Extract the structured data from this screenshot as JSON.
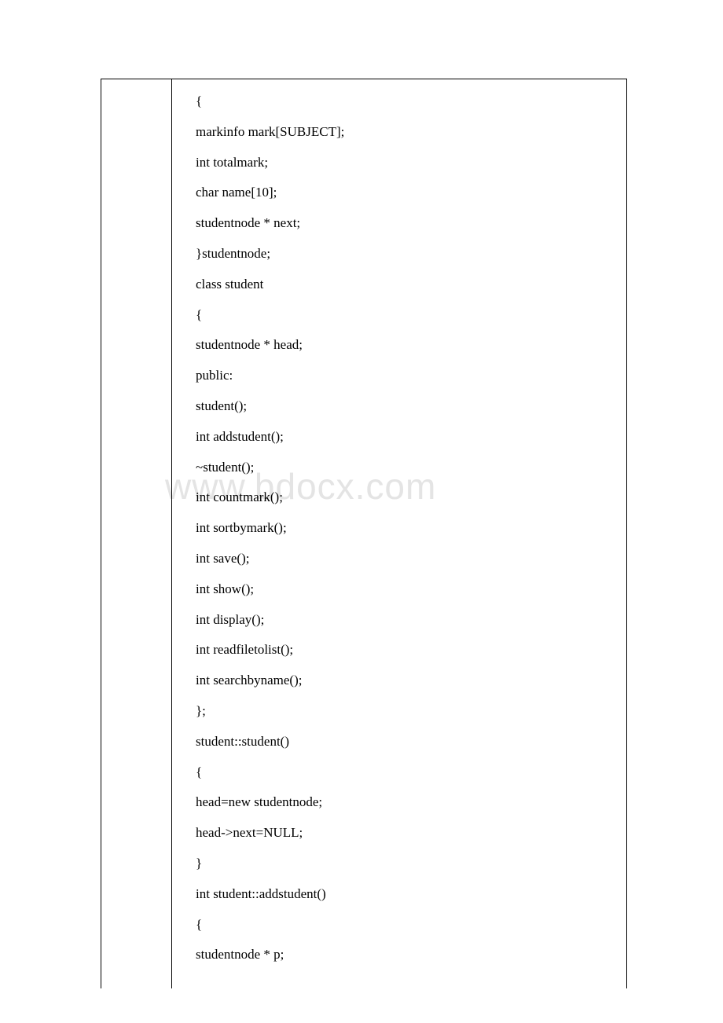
{
  "watermark": "www.bdocx.com",
  "code": {
    "lines": [
      "{",
      "markinfo mark[SUBJECT];",
      "int totalmark;",
      "char name[10];",
      "studentnode * next;",
      "}studentnode;",
      "class student",
      "{",
      "studentnode * head;",
      "public:",
      "student();",
      "int addstudent();",
      "~student();",
      "int countmark();",
      "int sortbymark();",
      "int save();",
      "int show();",
      "int display();",
      "int readfiletolist();",
      "int searchbyname();",
      "};",
      "student::student()",
      "{",
      "head=new studentnode;",
      "head->next=NULL;",
      "}",
      "int student::addstudent()",
      "{",
      "studentnode * p;"
    ]
  }
}
